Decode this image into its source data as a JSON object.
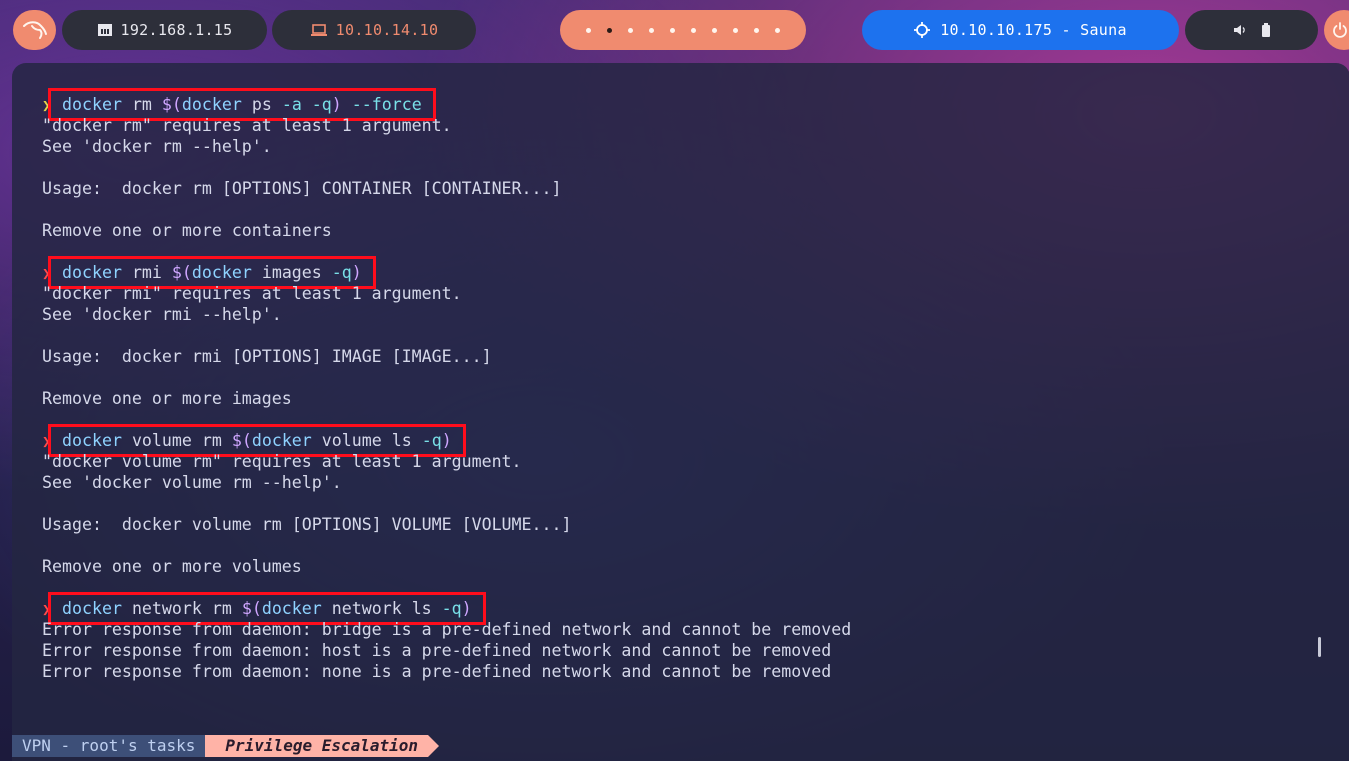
{
  "topbar": {
    "launcher_icon": "kali-dragon-icon",
    "local_ip": "192.168.1.15",
    "local_ip_icon": "ethernet-icon",
    "vpn_ip": "10.10.14.10",
    "vpn_ip_icon": "laptop-icon",
    "workspaces": [
      "1",
      "2",
      "3",
      "4",
      "5",
      "6",
      "7",
      "8",
      "9",
      "10"
    ],
    "active_workspace": 2,
    "target": "10.10.10.175 - Sauna",
    "target_icon": "crosshair-icon",
    "volume_icon": "speaker-icon",
    "battery_icon": "battery-icon",
    "power_icon": "power-icon"
  },
  "terminal": {
    "blocks": [
      {
        "prompt": "❯",
        "command": {
          "cmd": "docker",
          "args": " rm ",
          "sub_open": "$(",
          "sub_cmd": "docker",
          "sub_args": " ps ",
          "flags": "-a -q",
          "sub_close": ")",
          "tail": " --force"
        },
        "output": [
          "\"docker rm\" requires at least 1 argument.",
          "See 'docker rm --help'.",
          "",
          "Usage:  docker rm [OPTIONS] CONTAINER [CONTAINER...]",
          "",
          "Remove one or more containers",
          ""
        ]
      },
      {
        "prompt": "❯",
        "command": {
          "cmd": "docker",
          "args": " rmi ",
          "sub_open": "$(",
          "sub_cmd": "docker",
          "sub_args": " images ",
          "flags": "-q",
          "sub_close": ")",
          "tail": ""
        },
        "output": [
          "\"docker rmi\" requires at least 1 argument.",
          "See 'docker rmi --help'.",
          "",
          "Usage:  docker rmi [OPTIONS] IMAGE [IMAGE...]",
          "",
          "Remove one or more images",
          ""
        ]
      },
      {
        "prompt": "❯",
        "command": {
          "cmd": "docker",
          "args": " volume rm ",
          "sub_open": "$(",
          "sub_cmd": "docker",
          "sub_args": " volume ls ",
          "flags": "-q",
          "sub_close": ")",
          "tail": ""
        },
        "output": [
          "\"docker volume rm\" requires at least 1 argument.",
          "See 'docker volume rm --help'.",
          "",
          "Usage:  docker volume rm [OPTIONS] VOLUME [VOLUME...]",
          "",
          "Remove one or more volumes",
          ""
        ]
      },
      {
        "prompt": "❯",
        "command": {
          "cmd": "docker",
          "args": " network rm ",
          "sub_open": "$(",
          "sub_cmd": "docker",
          "sub_args": " network ls ",
          "flags": "-q",
          "sub_close": ")",
          "tail": ""
        },
        "output": [
          "Error response from daemon: bridge is a pre-defined network and cannot be removed",
          "Error response from daemon: host is a pre-defined network and cannot be removed",
          "Error response from daemon: none is a pre-defined network and cannot be removed"
        ]
      }
    ]
  },
  "statusbar": {
    "tasks_label": "VPN - root's tasks",
    "window_title": "Privilege Escalation"
  }
}
